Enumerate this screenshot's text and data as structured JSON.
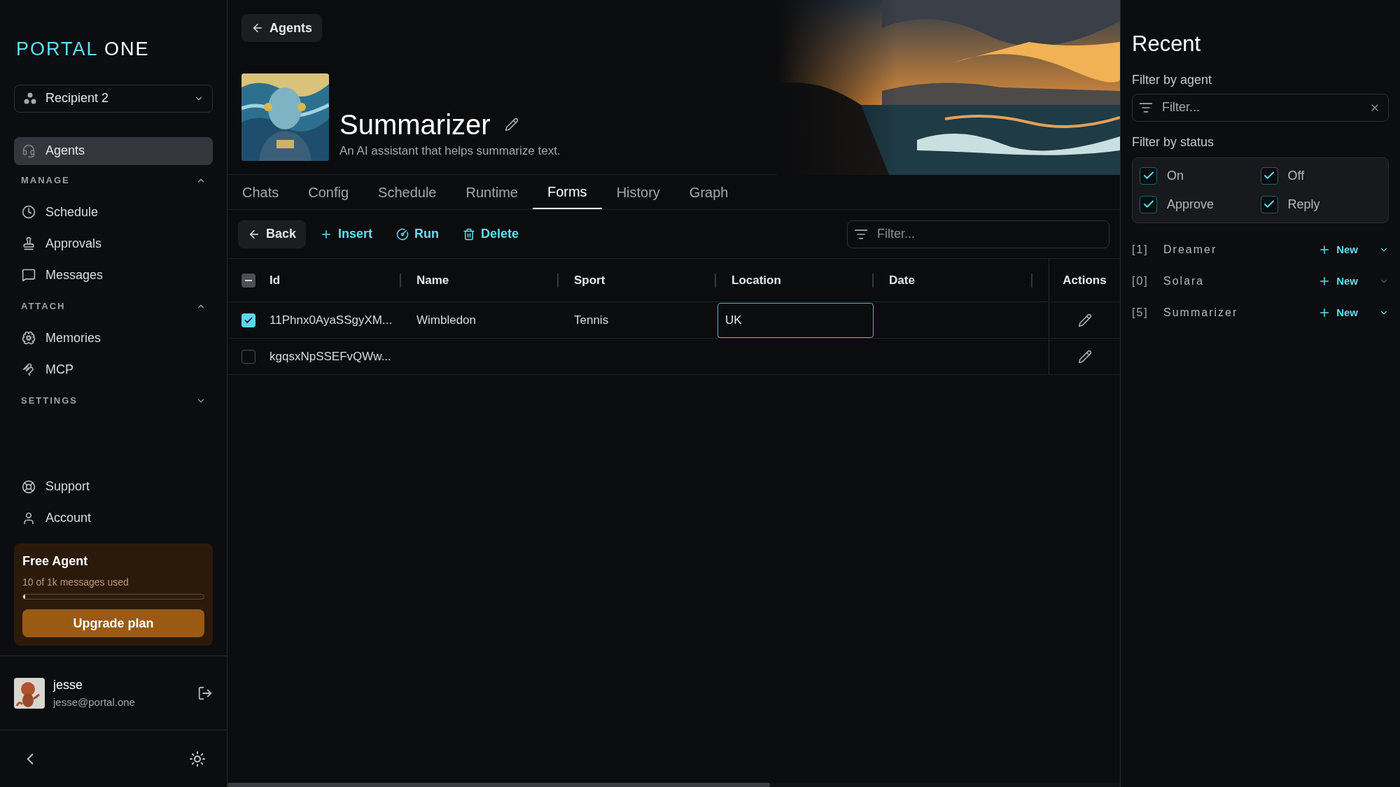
{
  "brand": {
    "first": "PORTAL",
    "second": "ONE"
  },
  "workspace": {
    "value": "Recipient 2"
  },
  "nav": {
    "top": [
      {
        "label": "Agents",
        "selected": true
      }
    ],
    "sections": [
      {
        "label": "MANAGE",
        "expanded": true,
        "items": [
          {
            "label": "Schedule",
            "selected": false
          },
          {
            "label": "Approvals",
            "selected": false
          },
          {
            "label": "Messages",
            "selected": false
          }
        ]
      },
      {
        "label": "ATTACH",
        "expanded": true,
        "items": [
          {
            "label": "Memories",
            "selected": false
          },
          {
            "label": "MCP",
            "selected": false
          }
        ]
      },
      {
        "label": "SETTINGS",
        "expanded": false
      }
    ],
    "bottom": [
      {
        "label": "Support"
      },
      {
        "label": "Account"
      }
    ]
  },
  "plan": {
    "title": "Free Agent",
    "usage": "10 of 1k messages used",
    "level": 0.01,
    "button": "Upgrade plan"
  },
  "user": {
    "name": "jesse",
    "email": "jesse@portal.one"
  },
  "header": {
    "back": "Agents",
    "title": "Summarizer",
    "description": "An AI assistant that helps summarize text."
  },
  "tabs": [
    {
      "label": "Chats",
      "selected": false
    },
    {
      "label": "Config",
      "selected": false
    },
    {
      "label": "Schedule",
      "selected": false
    },
    {
      "label": "Runtime",
      "selected": false
    },
    {
      "label": "Forms",
      "selected": true
    },
    {
      "label": "History",
      "selected": false
    },
    {
      "label": "Graph",
      "selected": false
    }
  ],
  "toolbar": {
    "buttons": [
      {
        "label": "Back",
        "kind": "plain"
      },
      {
        "label": "Insert",
        "kind": "accent"
      },
      {
        "label": "Run",
        "kind": "accent"
      },
      {
        "label": "Delete",
        "kind": "accent"
      }
    ],
    "filter": {
      "placeholder": "Filter..."
    }
  },
  "table": {
    "partially_selected": true,
    "columns": [
      "Id",
      "Name",
      "Sport",
      "Location",
      "Date"
    ],
    "actions_column": "Actions",
    "rows": [
      {
        "selected": true,
        "editing": true,
        "id": "11Phnx0AyaSSgyXM...",
        "name": "Wimbledon",
        "sport": "Tennis",
        "location": "UK"
      },
      {
        "selected": false,
        "editing": false,
        "id": "kgqsxNpSSEFvQWw..."
      }
    ]
  },
  "recent": {
    "title": "Recent",
    "agent_filter": {
      "label": "Filter by agent",
      "placeholder": "Filter..."
    },
    "status_filter": {
      "label": "Filter by status",
      "options": [
        {
          "label": "On",
          "checked": true
        },
        {
          "label": "Off",
          "checked": true
        },
        {
          "label": "Approve",
          "checked": true
        },
        {
          "label": "Reply",
          "checked": true
        }
      ]
    },
    "agents": [
      {
        "count": "[1]",
        "name": "Dreamer",
        "action": "New",
        "disabled": false
      },
      {
        "count": "[0]",
        "name": "Solara",
        "action": "New",
        "disabled": true
      },
      {
        "count": "[5]",
        "name": "Summarizer",
        "action": "New",
        "disabled": false
      }
    ]
  }
}
